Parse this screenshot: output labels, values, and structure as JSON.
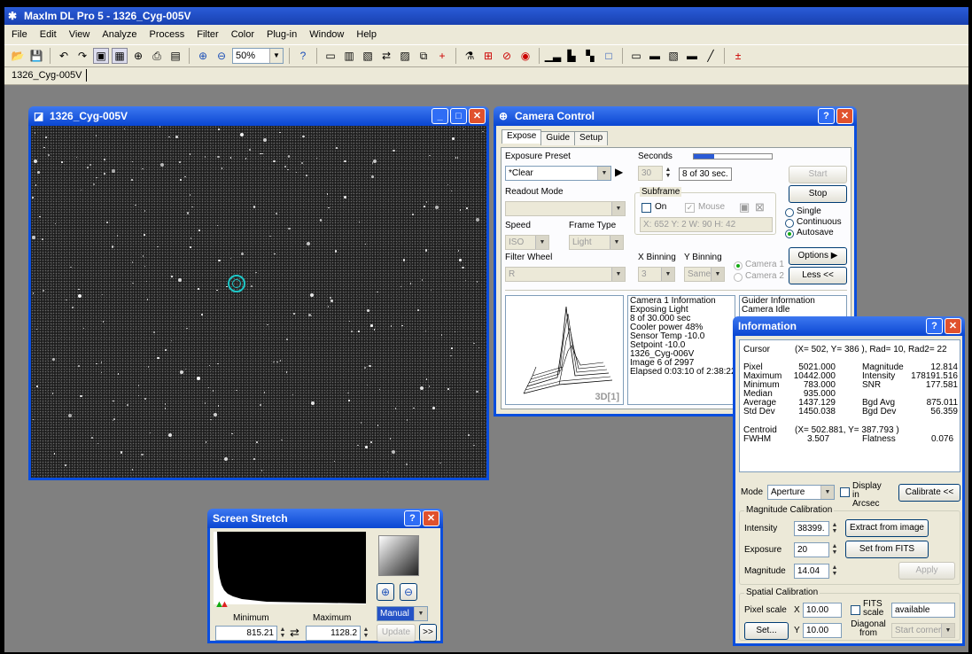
{
  "app_title": "MaxIm DL Pro 5 - 1326_Cyg-005V",
  "menu": [
    "File",
    "Edit",
    "View",
    "Analyze",
    "Process",
    "Filter",
    "Color",
    "Plug-in",
    "Window",
    "Help"
  ],
  "zoom": "50%",
  "doc_tab": "1326_Cyg-005V",
  "image_window": {
    "title": "1326_Cyg-005V"
  },
  "camera": {
    "title": "Camera Control",
    "tabs": [
      "Expose",
      "Guide",
      "Setup"
    ],
    "exposure_preset_label": "Exposure Preset",
    "exposure_preset": "*Clear",
    "seconds_label": "Seconds",
    "seconds": "30",
    "progress_text": "8 of 30 sec.",
    "progress": 0.267,
    "readout_label": "Readout Mode",
    "subframe_label": "Subframe",
    "on_label": "On",
    "mouse_label": "Mouse",
    "subframe_coords": "X: 652 Y:  2 W:  90 H:  42",
    "speed_label": "Speed",
    "frametype_label": "Frame Type",
    "speed": "ISO",
    "frametype": "Light",
    "filterwheel_label": "Filter Wheel",
    "filter": "R",
    "xbin_label": "X Binning",
    "ybin_label": "Y Binning",
    "xbin": "3",
    "ybin": "Same",
    "cam1_label": "Camera 1",
    "cam2_label": "Camera 2",
    "start": "Start",
    "stop": "Stop",
    "single": "Single",
    "continuous": "Continuous",
    "autosave": "Autosave",
    "options": "Options",
    "less": "Less <<",
    "label_3d": "3D[1]",
    "cam1_info": [
      "Camera 1 Information",
      "Exposing Light",
      "8 of 30.000 sec",
      "Cooler power 48%",
      "Sensor Temp -10.0",
      "Setpoint -10.0",
      "1326_Cyg-006V",
      "Image 6 of 2997",
      "Elapsed 0:03:10 of 2:38:22"
    ],
    "guider_info": [
      "Guider Information",
      "Camera Idle"
    ]
  },
  "information": {
    "title": "Information",
    "cursor_label": "Cursor",
    "cursor": "(X= 502, Y= 386 ), Rad= 10, Rad2= 22",
    "left_labels": [
      "Pixel",
      "Maximum",
      "Minimum",
      "Median",
      "Average",
      "Std Dev"
    ],
    "left_values": [
      "5021.000",
      "10442.000",
      "783.000",
      "935.000",
      "1437.129",
      "1450.038"
    ],
    "right_labels": [
      "Magnitude",
      "Intensity",
      "SNR",
      "",
      "Bgd Avg",
      "Bgd Dev"
    ],
    "right_values": [
      "12.814",
      "178191.516",
      "177.581",
      "",
      "875.011",
      "56.359"
    ],
    "centroid_label": "Centroid",
    "centroid": "(X= 502.881, Y= 387.793 )",
    "fwhm_label": "FWHM",
    "fwhm": "3.507",
    "flatness_label": "Flatness",
    "flatness": "0.076",
    "mode_label": "Mode",
    "mode": "Aperture",
    "display_arcsec": "Display in Arcsec",
    "calibrate": "Calibrate <<",
    "mag_cal_label": "Magnitude Calibration",
    "intensity_label": "Intensity",
    "intensity": "38399.",
    "extract": "Extract from image",
    "exposure_label": "Exposure",
    "exposure": "20",
    "set_fits": "Set from FITS",
    "magnitude_label": "Magnitude",
    "magnitude": "14.04",
    "apply": "Apply",
    "spatial_label": "Spatial Calibration",
    "pixel_scale_label": "Pixel scale",
    "x_label": "X",
    "pixel_x": "10.00",
    "y_label": "Y",
    "pixel_y": "10.00",
    "fits_scale": "FITS scale",
    "available": "available",
    "set": "Set...",
    "diag_label": "Diagonal from",
    "diag": "Start corner"
  },
  "stretch": {
    "title": "Screen Stretch",
    "min_label": "Minimum",
    "max_label": "Maximum",
    "min": "815.21",
    "max": "1128.2",
    "mode": "Manual",
    "update": "Update",
    "more": ">>"
  }
}
